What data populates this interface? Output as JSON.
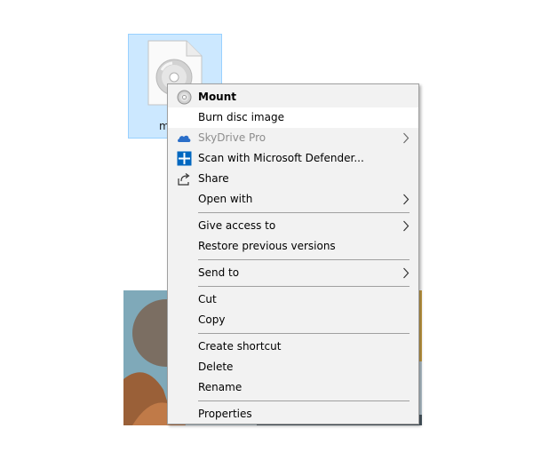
{
  "desktop": {
    "file_label": "m"
  },
  "context_menu": {
    "items": [
      {
        "id": "mount",
        "label": "Mount"
      },
      {
        "id": "burn",
        "label": "Burn disc image"
      },
      {
        "id": "skydrive",
        "label": "SkyDrive Pro"
      },
      {
        "id": "scan",
        "label": "Scan with Microsoft Defender..."
      },
      {
        "id": "share",
        "label": "Share"
      },
      {
        "id": "open_with",
        "label": "Open with"
      },
      {
        "id": "give_access",
        "label": "Give access to"
      },
      {
        "id": "restore",
        "label": "Restore previous versions"
      },
      {
        "id": "send_to",
        "label": "Send to"
      },
      {
        "id": "cut",
        "label": "Cut"
      },
      {
        "id": "copy",
        "label": "Copy"
      },
      {
        "id": "create_shortcut",
        "label": "Create shortcut"
      },
      {
        "id": "delete",
        "label": "Delete"
      },
      {
        "id": "rename",
        "label": "Rename"
      },
      {
        "id": "properties",
        "label": "Properties"
      }
    ]
  },
  "icons": {
    "mount": "disc-icon",
    "skydrive": "cloud-icon",
    "scan": "defender-shield-icon",
    "share": "share-icon",
    "submenu": "chevron-right-icon"
  },
  "colors": {
    "selection_fill": "#cce8ff",
    "selection_border": "#99d1ff",
    "menu_background": "#f2f2f2",
    "menu_highlight": "#ffffff",
    "disabled_text": "#8d8d8d",
    "accent_blue": "#0067c0"
  }
}
